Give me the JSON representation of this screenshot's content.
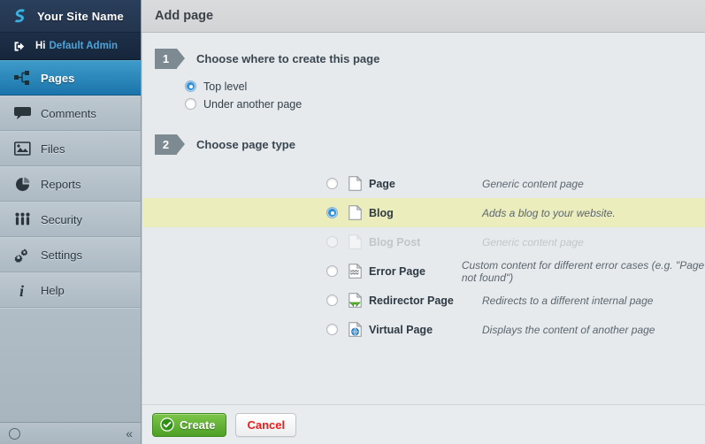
{
  "sidebar": {
    "brand": {
      "title": "Your Site Name",
      "logo_icon": "s-logo-icon"
    },
    "user": {
      "greeting": "Hi",
      "name": "Default Admin",
      "icon": "logout-arrow-icon"
    },
    "items": [
      {
        "label": "Pages",
        "icon": "sitemap-icon",
        "active": true
      },
      {
        "label": "Comments",
        "icon": "comment-icon",
        "active": false
      },
      {
        "label": "Files",
        "icon": "image-icon",
        "active": false
      },
      {
        "label": "Reports",
        "icon": "piechart-icon",
        "active": false
      },
      {
        "label": "Security",
        "icon": "people-icon",
        "active": false
      },
      {
        "label": "Settings",
        "icon": "gears-icon",
        "active": false
      },
      {
        "label": "Help",
        "icon": "info-icon",
        "active": false
      }
    ],
    "footer": {
      "status_icon": "circle-icon",
      "collapse_icon": "double-chevron-left-icon",
      "collapse_label": "«"
    }
  },
  "header": {
    "title": "Add page"
  },
  "steps": [
    {
      "number": "1",
      "title": "Choose where to create this page"
    },
    {
      "number": "2",
      "title": "Choose page type"
    }
  ],
  "location_options": [
    {
      "label": "Top level",
      "selected": true
    },
    {
      "label": "Under another page",
      "selected": false
    }
  ],
  "page_types": [
    {
      "name": "Page",
      "description": "Generic content page",
      "icon": "document-icon",
      "selected": false,
      "disabled": false
    },
    {
      "name": "Blog",
      "description": "Adds a blog to your website.",
      "icon": "document-icon",
      "selected": true,
      "disabled": false
    },
    {
      "name": "Blog Post",
      "description": "Generic content page",
      "icon": "document-icon",
      "selected": false,
      "disabled": true
    },
    {
      "name": "Error Page",
      "description": "Custom content for different error cases (e.g. \"Page not found\")",
      "icon": "error-document-icon",
      "selected": false,
      "disabled": false
    },
    {
      "name": "Redirector Page",
      "description": "Redirects to a different internal page",
      "icon": "redirect-document-icon",
      "selected": false,
      "disabled": false
    },
    {
      "name": "Virtual Page",
      "description": "Displays the content of another page",
      "icon": "globe-document-icon",
      "selected": false,
      "disabled": false
    }
  ],
  "actions": {
    "create_label": "Create",
    "create_icon": "check-circle-icon",
    "cancel_label": "Cancel"
  },
  "colors": {
    "accent_blue": "#1b74ab",
    "highlight_yellow": "#ecedbc",
    "create_green": "#4da026",
    "cancel_red": "#ee1c1c",
    "sidebar_dark": "#23344d"
  }
}
